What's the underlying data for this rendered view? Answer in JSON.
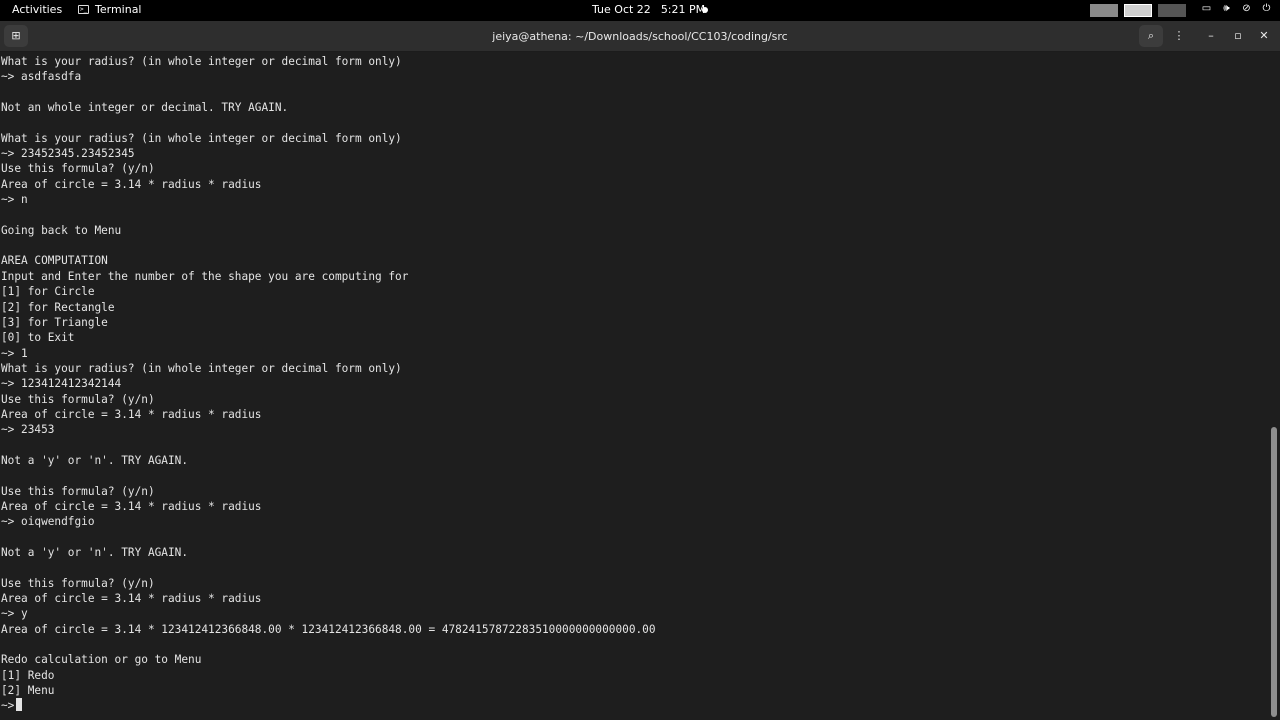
{
  "topbar": {
    "activities": "Activities",
    "app_name": "Terminal",
    "app_icon": ">_",
    "date": "Tue Oct 22",
    "time": "5:21 PM"
  },
  "window": {
    "title": "jeiya@athena: ~/Downloads/school/CC103/coding/src"
  },
  "terminal": {
    "lines": [
      "What is your radius? (in whole integer or decimal form only)",
      "~> asdfasdfa",
      "",
      "Not an whole integer or decimal. TRY AGAIN.",
      "",
      "What is your radius? (in whole integer or decimal form only)",
      "~> 23452345.23452345",
      "Use this formula? (y/n)",
      "Area of circle = 3.14 * radius * radius",
      "~> n",
      "",
      "Going back to Menu",
      "",
      "AREA COMPUTATION",
      "Input and Enter the number of the shape you are computing for",
      "[1] for Circle",
      "[2] for Rectangle",
      "[3] for Triangle",
      "[0] to Exit",
      "~> 1",
      "What is your radius? (in whole integer or decimal form only)",
      "~> 123412412342144",
      "Use this formula? (y/n)",
      "Area of circle = 3.14 * radius * radius",
      "~> 23453",
      "",
      "Not a 'y' or 'n'. TRY AGAIN.",
      "",
      "Use this formula? (y/n)",
      "Area of circle = 3.14 * radius * radius",
      "~> oiqwendfgio",
      "",
      "Not a 'y' or 'n'. TRY AGAIN.",
      "",
      "Use this formula? (y/n)",
      "Area of circle = 3.14 * radius * radius",
      "~> y",
      "Area of circle = 3.14 * 123412412366848.00 * 123412412366848.00 = 47824157872283510000000000000.00",
      "",
      "Redo calculation or go to Menu",
      "[1] Redo",
      "[2] Menu"
    ],
    "prompt": "~> "
  }
}
